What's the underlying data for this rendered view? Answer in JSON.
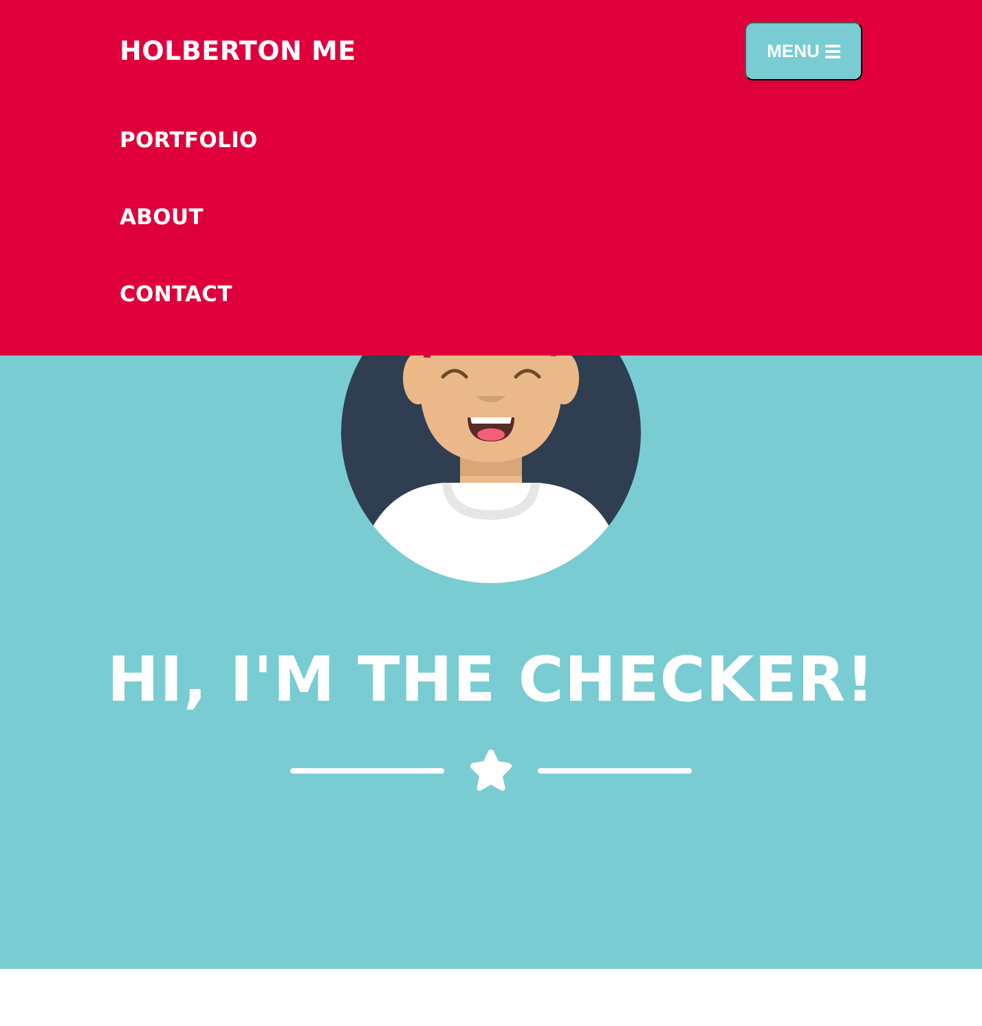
{
  "navbar": {
    "brand": "HOLBERTON ME",
    "menu_button_label": "MENU",
    "menu_icon": "hamburger-icon",
    "items": [
      {
        "label": "PORTFOLIO"
      },
      {
        "label": "ABOUT"
      },
      {
        "label": "CONTACT"
      }
    ]
  },
  "hero": {
    "avatar": "smiling-person-avatar",
    "title": "HI, I'M THE CHECKER!",
    "divider_icon": "star-icon"
  },
  "colors": {
    "navbar_background": "#df003b",
    "hero_background": "#79ccd2",
    "text": "#ffffff",
    "avatar_background": "#2f3e51",
    "skin": "#ebb989",
    "page_background": "#ffffff"
  }
}
